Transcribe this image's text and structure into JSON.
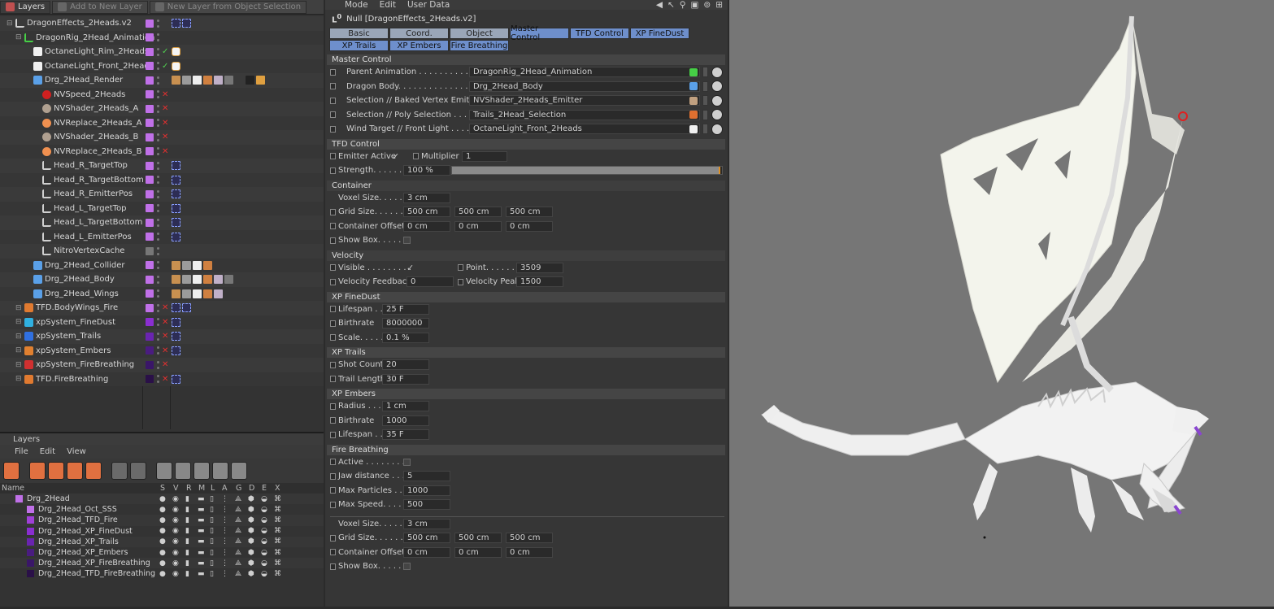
{
  "object_manager": {
    "tabs": [
      "Layers",
      "Add to New Layer",
      "New Layer from Object Selection"
    ],
    "objects": [
      {
        "name": "DragonEffects_2Heads.v2",
        "indent": 0,
        "icon": "null-icon",
        "color": "#c070e8",
        "flag": "",
        "tags": [
          "xpresso-tag",
          "xpresso-tag"
        ]
      },
      {
        "name": "DragonRig_2Head_Animation",
        "indent": 1,
        "icon": "null-green-icon",
        "color": "#c070e8",
        "flag": "",
        "tags": []
      },
      {
        "name": "OctaneLight_Rim_2Heads",
        "indent": 2,
        "icon": "light-icon",
        "color": "#c070e8",
        "flag": "✓",
        "tags": [
          "light-tag"
        ]
      },
      {
        "name": "OctaneLight_Front_2Heads",
        "indent": 2,
        "icon": "light-icon",
        "color": "#c070e8",
        "flag": "✓",
        "tags": [
          "light-tag"
        ]
      },
      {
        "name": "Drg_2Head_Render",
        "indent": 2,
        "icon": "mesh-icon",
        "color": "#c070e8",
        "flag": "",
        "tags": [
          "t1",
          "t2",
          "t3",
          "t4",
          "t5",
          "t6",
          "t7",
          "t8",
          "t9"
        ]
      },
      {
        "name": "NVSpeed_2Heads",
        "indent": 3,
        "icon": "sphere-red-icon",
        "color": "#c070e8",
        "flag": "✕",
        "tags": []
      },
      {
        "name": "NVShader_2Heads_A",
        "indent": 3,
        "icon": "sphere-grey-icon",
        "color": "#c070e8",
        "flag": "✕",
        "tags": []
      },
      {
        "name": "NVReplace_2Heads_A",
        "indent": 3,
        "icon": "sphere-orange-icon",
        "color": "#c070e8",
        "flag": "✕",
        "tags": []
      },
      {
        "name": "NVShader_2Heads_B",
        "indent": 3,
        "icon": "sphere-grey-icon",
        "color": "#c070e8",
        "flag": "✕",
        "tags": []
      },
      {
        "name": "NVReplace_2Heads_B",
        "indent": 3,
        "icon": "sphere-orange-icon",
        "color": "#c070e8",
        "flag": "✕",
        "tags": []
      },
      {
        "name": "Head_R_TargetTop",
        "indent": 3,
        "icon": "null-icon",
        "color": "#c070e8",
        "flag": "",
        "tags": [
          "xpresso-tag"
        ]
      },
      {
        "name": "Head_R_TargetBottom",
        "indent": 3,
        "icon": "null-icon",
        "color": "#c070e8",
        "flag": "",
        "tags": [
          "xpresso-tag"
        ]
      },
      {
        "name": "Head_R_EmitterPos",
        "indent": 3,
        "icon": "null-icon",
        "color": "#c070e8",
        "flag": "",
        "tags": [
          "xpresso-tag"
        ]
      },
      {
        "name": "Head_L_TargetTop",
        "indent": 3,
        "icon": "null-icon",
        "color": "#c070e8",
        "flag": "",
        "tags": [
          "xpresso-tag"
        ]
      },
      {
        "name": "Head_L_TargetBottom",
        "indent": 3,
        "icon": "null-icon",
        "color": "#c070e8",
        "flag": "",
        "tags": [
          "xpresso-tag"
        ]
      },
      {
        "name": "Head_L_EmitterPos",
        "indent": 3,
        "icon": "null-icon",
        "color": "#c070e8",
        "flag": "",
        "tags": [
          "xpresso-tag"
        ]
      },
      {
        "name": "NitroVertexCache",
        "indent": 3,
        "icon": "null-icon",
        "color": "#777777",
        "flag": "",
        "tags": []
      },
      {
        "name": "Drg_2Head_Collider",
        "indent": 2,
        "icon": "mesh-icon",
        "color": "#c070e8",
        "flag": "",
        "tags": [
          "t1",
          "t2",
          "t3",
          "t4"
        ]
      },
      {
        "name": "Drg_2Head_Body",
        "indent": 2,
        "icon": "mesh-icon",
        "color": "#c070e8",
        "flag": "",
        "tags": [
          "t1",
          "t2",
          "t3",
          "t4",
          "t5",
          "t6"
        ]
      },
      {
        "name": "Drg_2Head_Wings",
        "indent": 2,
        "icon": "mesh-icon",
        "color": "#c070e8",
        "flag": "",
        "tags": [
          "t1",
          "t2",
          "t3",
          "t4",
          "t5"
        ]
      },
      {
        "name": "TFD.BodyWings_Fire",
        "indent": 1,
        "icon": "tfd-icon",
        "color": "#c070e8",
        "flag": "✕",
        "tags": [
          "xpresso-tag",
          "xpresso-tag"
        ]
      },
      {
        "name": "xpSystem_FineDust",
        "indent": 1,
        "icon": "xp-cyan-icon",
        "color": "#8a2ed0",
        "flag": "✕",
        "tags": [
          "xpresso-tag"
        ]
      },
      {
        "name": "xpSystem_Trails",
        "indent": 1,
        "icon": "xp-blue-icon",
        "color": "#6a24b0",
        "flag": "✕",
        "tags": [
          "xpresso-tag"
        ]
      },
      {
        "name": "xpSystem_Embers",
        "indent": 1,
        "icon": "xp-orange-icon",
        "color": "#4a1c80",
        "flag": "✕",
        "tags": [
          "xpresso-tag"
        ]
      },
      {
        "name": "xpSystem_FireBreathing",
        "indent": 1,
        "icon": "xp-red-icon",
        "color": "#3a1668",
        "flag": "✕",
        "tags": []
      },
      {
        "name": "TFD.FireBreathing",
        "indent": 1,
        "icon": "tfd-icon",
        "color": "#2a1048",
        "flag": "✕",
        "tags": [
          "xpresso-tag"
        ]
      }
    ]
  },
  "layer_manager": {
    "title": "Layers",
    "menu": [
      "File",
      "Edit",
      "View"
    ],
    "columns": [
      "Name",
      "S",
      "V",
      "R",
      "M",
      "L",
      "A",
      "G",
      "D",
      "E",
      "X"
    ],
    "layers": [
      {
        "name": "Drg_2Head",
        "color": "#c070e8",
        "indent": 0
      },
      {
        "name": "Drg_2Head_Oct_SSS",
        "color": "#c070e8",
        "indent": 1
      },
      {
        "name": "Drg_2Head_TFD_Fire",
        "color": "#a040d8",
        "indent": 1
      },
      {
        "name": "Drg_2Head_XP_FineDust",
        "color": "#8a2ed0",
        "indent": 1
      },
      {
        "name": "Drg_2Head_XP_Trails",
        "color": "#6a24b0",
        "indent": 1
      },
      {
        "name": "Drg_2Head_XP_Embers",
        "color": "#4a1c80",
        "indent": 1
      },
      {
        "name": "Drg_2Head_XP_FireBreathing",
        "color": "#3a1668",
        "indent": 1
      },
      {
        "name": "Drg_2Head_TFD_FireBreathing",
        "color": "#2a1048",
        "indent": 1
      }
    ]
  },
  "attributes": {
    "menu": [
      "Mode",
      "Edit",
      "User Data"
    ],
    "header": "Null [DragonEffects_2Heads.v2]",
    "tabs": [
      "Basic",
      "Coord.",
      "Object",
      "Master Control",
      "TFD Control",
      "XP FineDust",
      "XP Trails",
      "XP Embers",
      "Fire Breathing"
    ],
    "active_tabs": [
      "Master Control",
      "TFD Control",
      "XP FineDust",
      "XP Trails",
      "XP Embers",
      "Fire Breathing"
    ],
    "master_control": {
      "title": "Master Control",
      "links": [
        {
          "label": "Parent Animation . . . . . . . . . . . .",
          "value": "DragonRig_2Head_Animation"
        },
        {
          "label": "Dragon Body. . . . . . . . . . . . . . . . .",
          "value": "Drg_2Head_Body"
        },
        {
          "label": "Selection // Baked Vertex Emitter",
          "value": "NVShader_2Heads_Emitter"
        },
        {
          "label": "Selection // Poly Selection . . . . .",
          "value": "Trails_2Head_Selection"
        },
        {
          "label": "Wind Target // Front Light . . . . .",
          "value": "OctaneLight_Front_2Heads"
        }
      ]
    },
    "tfd_control": {
      "title": "TFD Control",
      "emitter_active_label": "Emitter Active",
      "emitter_active": "✓",
      "multiplier_label": "Multiplier",
      "multiplier": "1",
      "strength_label": "Strength. . . . . . .",
      "strength": "100 %",
      "strength_fraction": 1.0,
      "container_title": "Container",
      "voxel_label": "Voxel Size. . . . . .",
      "voxel": "3 cm",
      "grid_label": "Grid Size. . . . . . .",
      "grid": [
        "500 cm",
        "500 cm",
        "500 cm"
      ],
      "offset_label": "Container Offset",
      "offset": [
        "0 cm",
        "0 cm",
        "0 cm"
      ],
      "showbox_label": "Show Box. . . . . .",
      "velocity_title": "Velocity",
      "visible_label": "Visible . . . . . . . . .",
      "visible": "✓",
      "point_label": "Point. . . . . . . .",
      "point": "3509",
      "vel_feedback_label": "Velocity Feedback",
      "vel_feedback": "0",
      "vel_peak_label": "Velocity Peak",
      "vel_peak": "1500"
    },
    "xp_finedust": {
      "title": "XP FineDust",
      "rows": [
        {
          "label": "Lifespan . . . .",
          "value": "25 F"
        },
        {
          "label": "Birthrate",
          "value": "8000000"
        },
        {
          "label": "Scale. . . . . .",
          "value": "0.1 %"
        }
      ]
    },
    "xp_trails": {
      "title": "XP Trails",
      "rows": [
        {
          "label": "Shot Count",
          "value": "20"
        },
        {
          "label": "Trail Length",
          "value": "30 F"
        }
      ]
    },
    "xp_embers": {
      "title": "XP Embers",
      "rows": [
        {
          "label": "Radius . . . .",
          "value": "1 cm"
        },
        {
          "label": "Birthrate",
          "value": "1000"
        },
        {
          "label": "Lifespan . . . .",
          "value": "35 F"
        }
      ]
    },
    "fire_breathing": {
      "title": "Fire Breathing",
      "active_label": "Active . . . . . . . . .",
      "rows": [
        {
          "label": "Jaw distance . . . .",
          "value": "5"
        },
        {
          "label": "Max Particles . . . .",
          "value": "1000"
        },
        {
          "label": "Max Speed. . . . . .",
          "value": "500"
        }
      ],
      "voxel_label": "Voxel Size. . . . . .",
      "voxel": "3 cm",
      "grid_label": "Grid Size. . . . . . .",
      "grid": [
        "500 cm",
        "500 cm",
        "500 cm"
      ],
      "offset_label": "Container Offset",
      "offset": [
        "0 cm",
        "0 cm",
        "0 cm"
      ],
      "showbox_label": "Show Box. . . . . ."
    }
  },
  "viewport": {
    "background": "#767676",
    "model": "dragon-render"
  }
}
